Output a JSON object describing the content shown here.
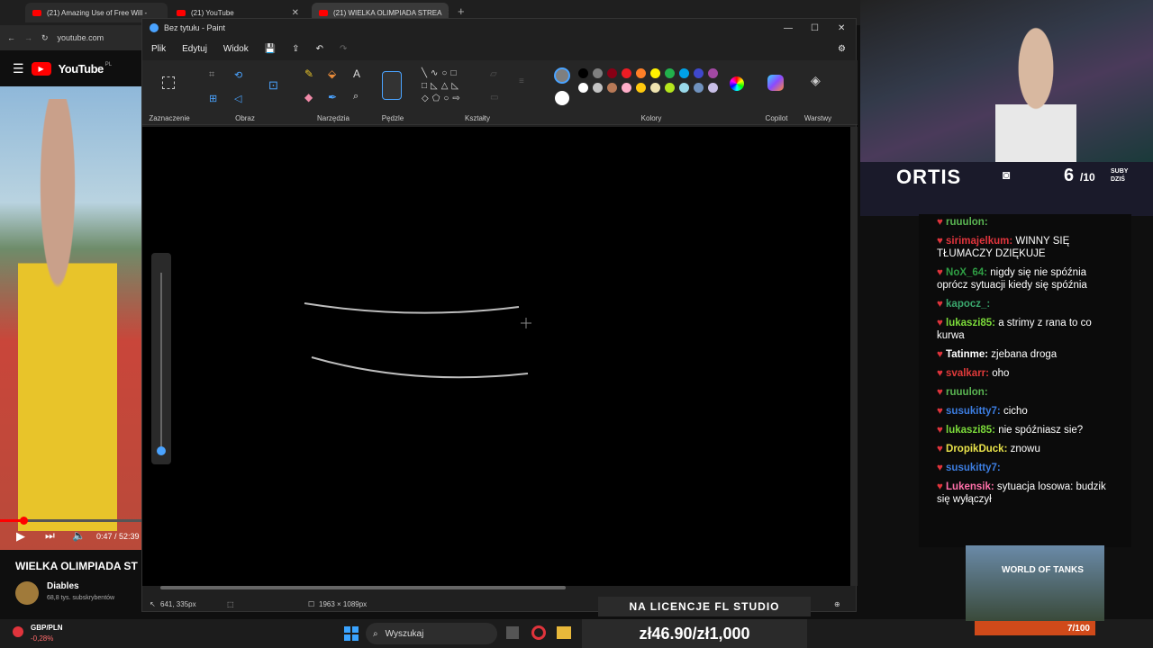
{
  "browser": {
    "tabs": [
      {
        "label": "(21) Amazing Use of Free Will -"
      },
      {
        "label": "(21) YouTube"
      },
      {
        "label": "(21) WIELKA OLIMPIADA STREA"
      }
    ],
    "url": "youtube.com"
  },
  "youtube": {
    "logo": "YouTube",
    "region": "PL",
    "time": "0:47 / 52:39",
    "video_title": "WIELKA OLIMPIADA ST",
    "channel": "Diables",
    "subs": "68,8 tys. subskrybentów",
    "progress_fraction": 0.015
  },
  "paint": {
    "title": "Bez tytułu - Paint",
    "menu": [
      "Plik",
      "Edytuj",
      "Widok"
    ],
    "groups": [
      "Zaznaczenie",
      "Obraz",
      "Narzędzia",
      "Pędzle",
      "Kształty",
      "Kolory",
      "Copilot",
      "Warstwy"
    ],
    "palette_row1": [
      "#000000",
      "#7f7f7f",
      "#880015",
      "#ed1c24",
      "#ff7f27",
      "#fff200",
      "#22b14c",
      "#00a2e8",
      "#3f48cc",
      "#a349a4"
    ],
    "palette_row2": [
      "#ffffff",
      "#c3c3c3",
      "#b97a57",
      "#ffaec9",
      "#ffc90e",
      "#efe4b0",
      "#b5e61d",
      "#99d9ea",
      "#7092be",
      "#c8bfe7"
    ],
    "status_pos": "641, 335px",
    "status_size": "1963 × 1089px"
  },
  "taskbar": {
    "ticker": "GBP/PLN",
    "ticker_change": "-0,28%",
    "search": "Wyszukaj",
    "price": "zł46.90/zł1,000"
  },
  "stream": {
    "name": "ORTIS",
    "subs_count": "6",
    "subs_goal": "/10",
    "subs_label": "SUBY DZIŚ",
    "banner": "NA LICENCJE FL STUDIO",
    "goal": "7/100",
    "ad_title": "WORLD OF TANKS",
    "chat": [
      {
        "user": "ruuulon:",
        "color": "#5ab552",
        "text": ""
      },
      {
        "user": "sirimajelkum:",
        "color": "#e0343c",
        "text": "WINNY SIĘ TŁUMACZY DZIĘKUJE"
      },
      {
        "user": "NoX_64:",
        "color": "#2f9e44",
        "text": "nigdy się nie spóźnia oprócz sytuacji kiedy się spóźnia"
      },
      {
        "user": "kapocz_:",
        "color": "#3aa76d",
        "text": ""
      },
      {
        "user": "lukaszi85:",
        "color": "#7cdb3a",
        "text": "a strimy z rana to co kurwa"
      },
      {
        "user": "Tatinme:",
        "color": "#ffffff",
        "text": "zjebana droga"
      },
      {
        "user": "svalkarr:",
        "color": "#e03a3a",
        "text": "oho"
      },
      {
        "user": "ruuulon:",
        "color": "#5ab552",
        "text": ""
      },
      {
        "user": "susukitty7:",
        "color": "#3c7de0",
        "text": "cicho"
      },
      {
        "user": "lukaszi85:",
        "color": "#7cdb3a",
        "text": "nie spóźniasz sie?"
      },
      {
        "user": "DropikDuck:",
        "color": "#e8e24a",
        "text": "znowu"
      },
      {
        "user": "susukitty7:",
        "color": "#3c7de0",
        "text": ""
      },
      {
        "user": "Lukensik:",
        "color": "#ff6fa8",
        "text": "sytuacja losowa: budzik się wyłączył"
      }
    ]
  }
}
